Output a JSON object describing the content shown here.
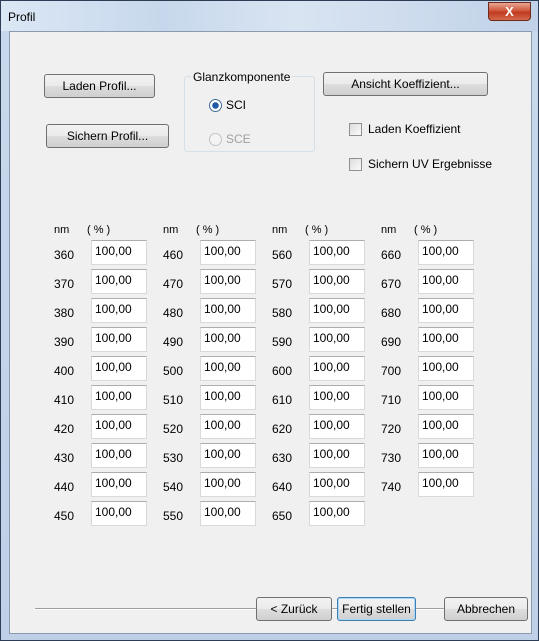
{
  "window": {
    "title": "Profil",
    "close_symbol": "X"
  },
  "buttons": {
    "load_profile": "Laden Profil...",
    "save_profile": "Sichern Profil...",
    "view_coefficient": "Ansicht Koeffizient...",
    "back": "< Zurück",
    "finish": "Fertig stellen",
    "cancel": "Abbrechen"
  },
  "gloss": {
    "label": "Glanzkomponente",
    "options": [
      {
        "label": "SCI",
        "selected": true,
        "enabled": true
      },
      {
        "label": "SCE",
        "selected": false,
        "enabled": false
      }
    ]
  },
  "checkboxes": {
    "load_coefficient": {
      "label": "Laden Koeffizient",
      "checked": false
    },
    "save_uv": {
      "label": "Sichern UV Ergebnisse",
      "checked": false
    }
  },
  "table": {
    "head_nm": "nm",
    "head_pct": "( % )",
    "columns": [
      [
        {
          "nm": "360",
          "v": "100,00"
        },
        {
          "nm": "370",
          "v": "100,00"
        },
        {
          "nm": "380",
          "v": "100,00"
        },
        {
          "nm": "390",
          "v": "100,00"
        },
        {
          "nm": "400",
          "v": "100,00"
        },
        {
          "nm": "410",
          "v": "100,00"
        },
        {
          "nm": "420",
          "v": "100,00"
        },
        {
          "nm": "430",
          "v": "100,00"
        },
        {
          "nm": "440",
          "v": "100,00"
        },
        {
          "nm": "450",
          "v": "100,00"
        }
      ],
      [
        {
          "nm": "460",
          "v": "100,00"
        },
        {
          "nm": "470",
          "v": "100,00"
        },
        {
          "nm": "480",
          "v": "100,00"
        },
        {
          "nm": "490",
          "v": "100,00"
        },
        {
          "nm": "500",
          "v": "100,00"
        },
        {
          "nm": "510",
          "v": "100,00"
        },
        {
          "nm": "520",
          "v": "100,00"
        },
        {
          "nm": "530",
          "v": "100,00"
        },
        {
          "nm": "540",
          "v": "100,00"
        },
        {
          "nm": "550",
          "v": "100,00"
        }
      ],
      [
        {
          "nm": "560",
          "v": "100,00"
        },
        {
          "nm": "570",
          "v": "100,00"
        },
        {
          "nm": "580",
          "v": "100,00"
        },
        {
          "nm": "590",
          "v": "100,00"
        },
        {
          "nm": "600",
          "v": "100,00"
        },
        {
          "nm": "610",
          "v": "100,00"
        },
        {
          "nm": "620",
          "v": "100,00"
        },
        {
          "nm": "630",
          "v": "100,00"
        },
        {
          "nm": "640",
          "v": "100,00"
        },
        {
          "nm": "650",
          "v": "100,00"
        }
      ],
      [
        {
          "nm": "660",
          "v": "100,00"
        },
        {
          "nm": "670",
          "v": "100,00"
        },
        {
          "nm": "680",
          "v": "100,00"
        },
        {
          "nm": "690",
          "v": "100,00"
        },
        {
          "nm": "700",
          "v": "100,00"
        },
        {
          "nm": "710",
          "v": "100,00"
        },
        {
          "nm": "720",
          "v": "100,00"
        },
        {
          "nm": "730",
          "v": "100,00"
        },
        {
          "nm": "740",
          "v": "100,00"
        }
      ]
    ]
  },
  "colors": {
    "window_frame": "#c9d9ec",
    "client_bg": "#f0f0f0",
    "close_button": "#c8452a",
    "default_button_border": "#3c7fb1"
  }
}
